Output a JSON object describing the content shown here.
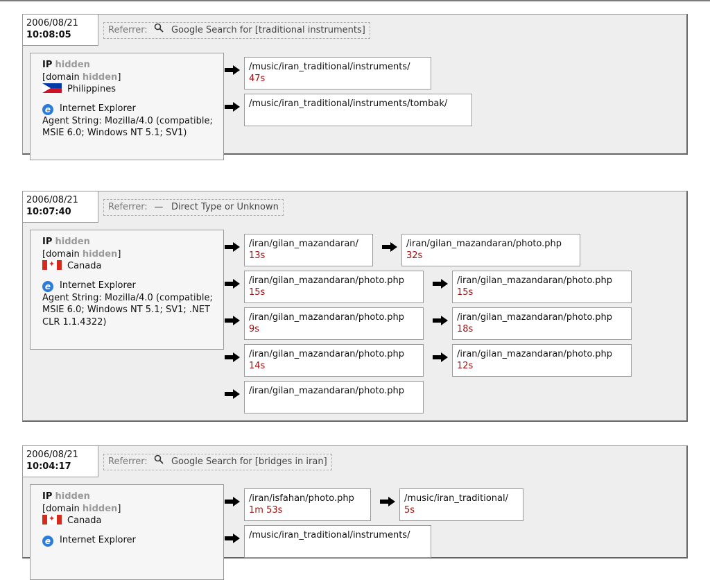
{
  "visits": [
    {
      "date": "2006/08/21",
      "time": "10:08:05",
      "referrer_label": "Referrer:",
      "referrer_icon": "search-icon",
      "referrer_text": "Google Search for [traditional instruments]",
      "ip_label": "IP",
      "ip_value": "hidden",
      "domain_label": "[domain",
      "domain_value": "hidden",
      "domain_close": "]",
      "country": "Philippines",
      "browser": "Internet Explorer",
      "agent": "Agent String: Mozilla/4.0 (compatible; MSIE 6.0; Windows NT 5.1; SV1)",
      "pages": [
        {
          "path": "/music/iran_traditional/instruments/",
          "duration": "47s"
        },
        {
          "path": "/music/iran_traditional/instruments/tombak/",
          "duration": ""
        }
      ]
    },
    {
      "date": "2006/08/21",
      "time": "10:07:40",
      "referrer_label": "Referrer:",
      "referrer_icon": "dash-icon",
      "referrer_text": "Direct Type or Unknown",
      "ip_label": "IP",
      "ip_value": "hidden",
      "domain_label": "[domain",
      "domain_value": "hidden",
      "domain_close": "]",
      "country": "Canada",
      "browser": "Internet Explorer",
      "agent": "Agent String: Mozilla/4.0 (compatible; MSIE 6.0; Windows NT 5.1; SV1; .NET CLR 1.1.4322)",
      "pages": [
        {
          "path": "/iran/gilan_mazandaran/",
          "duration": "13s"
        },
        {
          "path": "/iran/gilan_mazandaran/photo.php",
          "duration": "32s"
        },
        {
          "path": "/iran/gilan_mazandaran/photo.php",
          "duration": "15s"
        },
        {
          "path": "/iran/gilan_mazandaran/photo.php",
          "duration": "15s"
        },
        {
          "path": "/iran/gilan_mazandaran/photo.php",
          "duration": "9s"
        },
        {
          "path": "/iran/gilan_mazandaran/photo.php",
          "duration": "18s"
        },
        {
          "path": "/iran/gilan_mazandaran/photo.php",
          "duration": "14s"
        },
        {
          "path": "/iran/gilan_mazandaran/photo.php",
          "duration": "12s"
        },
        {
          "path": "/iran/gilan_mazandaran/photo.php",
          "duration": ""
        }
      ]
    },
    {
      "date": "2006/08/21",
      "time": "10:04:17",
      "referrer_label": "Referrer:",
      "referrer_icon": "search-icon",
      "referrer_text": "Google Search for [bridges in iran]",
      "ip_label": "IP",
      "ip_value": "hidden",
      "domain_label": "[domain",
      "domain_value": "hidden",
      "domain_close": "]",
      "country": "Canada",
      "browser": "Internet Explorer",
      "pages": [
        {
          "path": "/iran/isfahan/photo.php",
          "duration": "1m 53s"
        },
        {
          "path": "/music/iran_traditional/",
          "duration": "5s"
        },
        {
          "path": "/music/iran_traditional/instruments/",
          "duration": ""
        }
      ]
    }
  ]
}
